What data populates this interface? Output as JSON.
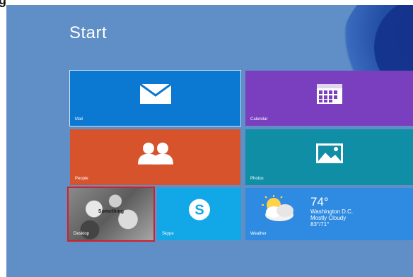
{
  "corner_glyph": "g",
  "start": {
    "title": "Start"
  },
  "tiles": {
    "mail": {
      "label": "Mail"
    },
    "calendar": {
      "label": "Calendar"
    },
    "people": {
      "label": "People"
    },
    "photos": {
      "label": "Photos"
    },
    "desktop": {
      "label": "Desktop",
      "caption": "Something"
    },
    "skype": {
      "label": "Skype"
    },
    "weather": {
      "label": "Weather",
      "temperature": "74°",
      "city": "Washington D.C.",
      "condition": "Mostly Cloudy",
      "range": "83°/71°"
    }
  },
  "colors": {
    "background": "#5f8fc6",
    "mail": "#0b78d1",
    "calendar": "#7a3fbf",
    "people": "#d7532b",
    "photos": "#0f8ea6",
    "skype": "#12a7e6",
    "weather": "#2f8be2",
    "selection_border": "#d3202a"
  },
  "icons": {
    "mail": "envelope-icon",
    "calendar": "calendar-grid-icon",
    "people": "people-icon",
    "photos": "landscape-photo-icon",
    "skype": "skype-s-icon",
    "weather": "cloud-sun-icon"
  }
}
